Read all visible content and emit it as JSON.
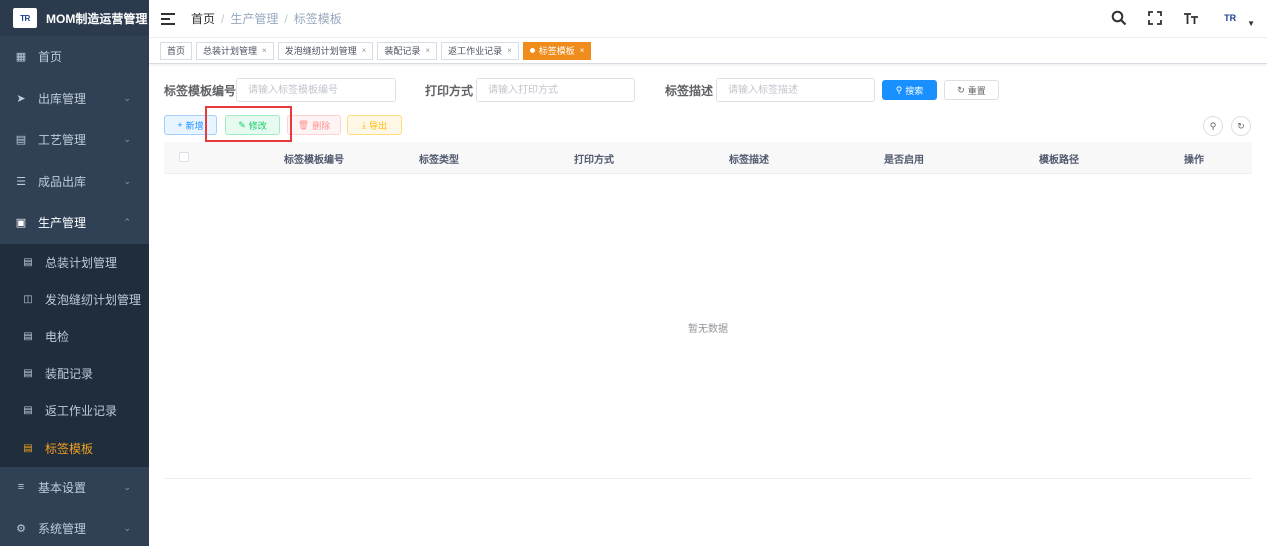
{
  "brand": {
    "logo_text": "TR",
    "title": "MOM制造运营管理"
  },
  "sidebar": {
    "items_top": [
      {
        "label": "首页",
        "icon": "dashboard-icon"
      },
      {
        "label": "出库管理",
        "icon": "send-icon"
      },
      {
        "label": "工艺管理",
        "icon": "craft-icon"
      },
      {
        "label": "成品出库",
        "icon": "list-icon"
      },
      {
        "label": "生产管理",
        "icon": "production-icon"
      }
    ],
    "submenu": [
      {
        "label": "总装计划管理"
      },
      {
        "label": "发泡缝纫计划管理"
      },
      {
        "label": "电检"
      },
      {
        "label": "装配记录"
      },
      {
        "label": "返工作业记录"
      },
      {
        "label": "标签模板"
      }
    ],
    "items_bottom": [
      {
        "label": "基本设置",
        "icon": "settings-sliders-icon"
      },
      {
        "label": "系统管理",
        "icon": "gear-icon"
      }
    ]
  },
  "breadcrumb": {
    "home": "首页",
    "level1": "生产管理",
    "level2": "标签模板"
  },
  "tags": [
    {
      "label": "首页"
    },
    {
      "label": "总装计划管理"
    },
    {
      "label": "发泡缝纫计划管理"
    },
    {
      "label": "装配记录"
    },
    {
      "label": "返工作业记录"
    },
    {
      "label": "标签模板"
    }
  ],
  "search": {
    "code_label": "标签模板编号",
    "code_placeholder": "请输入标签模板编号",
    "print_label": "打印方式",
    "print_placeholder": "请输入打印方式",
    "desc_label": "标签描述",
    "desc_placeholder": "请输入标签描述",
    "search_btn": "搜索",
    "reset_btn": "重置"
  },
  "toolbar": {
    "add": "新增",
    "edit": "修改",
    "delete": "删除",
    "export": "导出"
  },
  "table": {
    "columns": [
      "标签模板编号",
      "标签类型",
      "打印方式",
      "标签描述",
      "是否启用",
      "模板路径",
      "操作"
    ],
    "empty_text": "暂无数据"
  },
  "colors": {
    "sidebar_bg": "#304156",
    "active_accent": "#f0a020",
    "primary": "#1890ff",
    "highlight_box": "#e83b3b"
  }
}
